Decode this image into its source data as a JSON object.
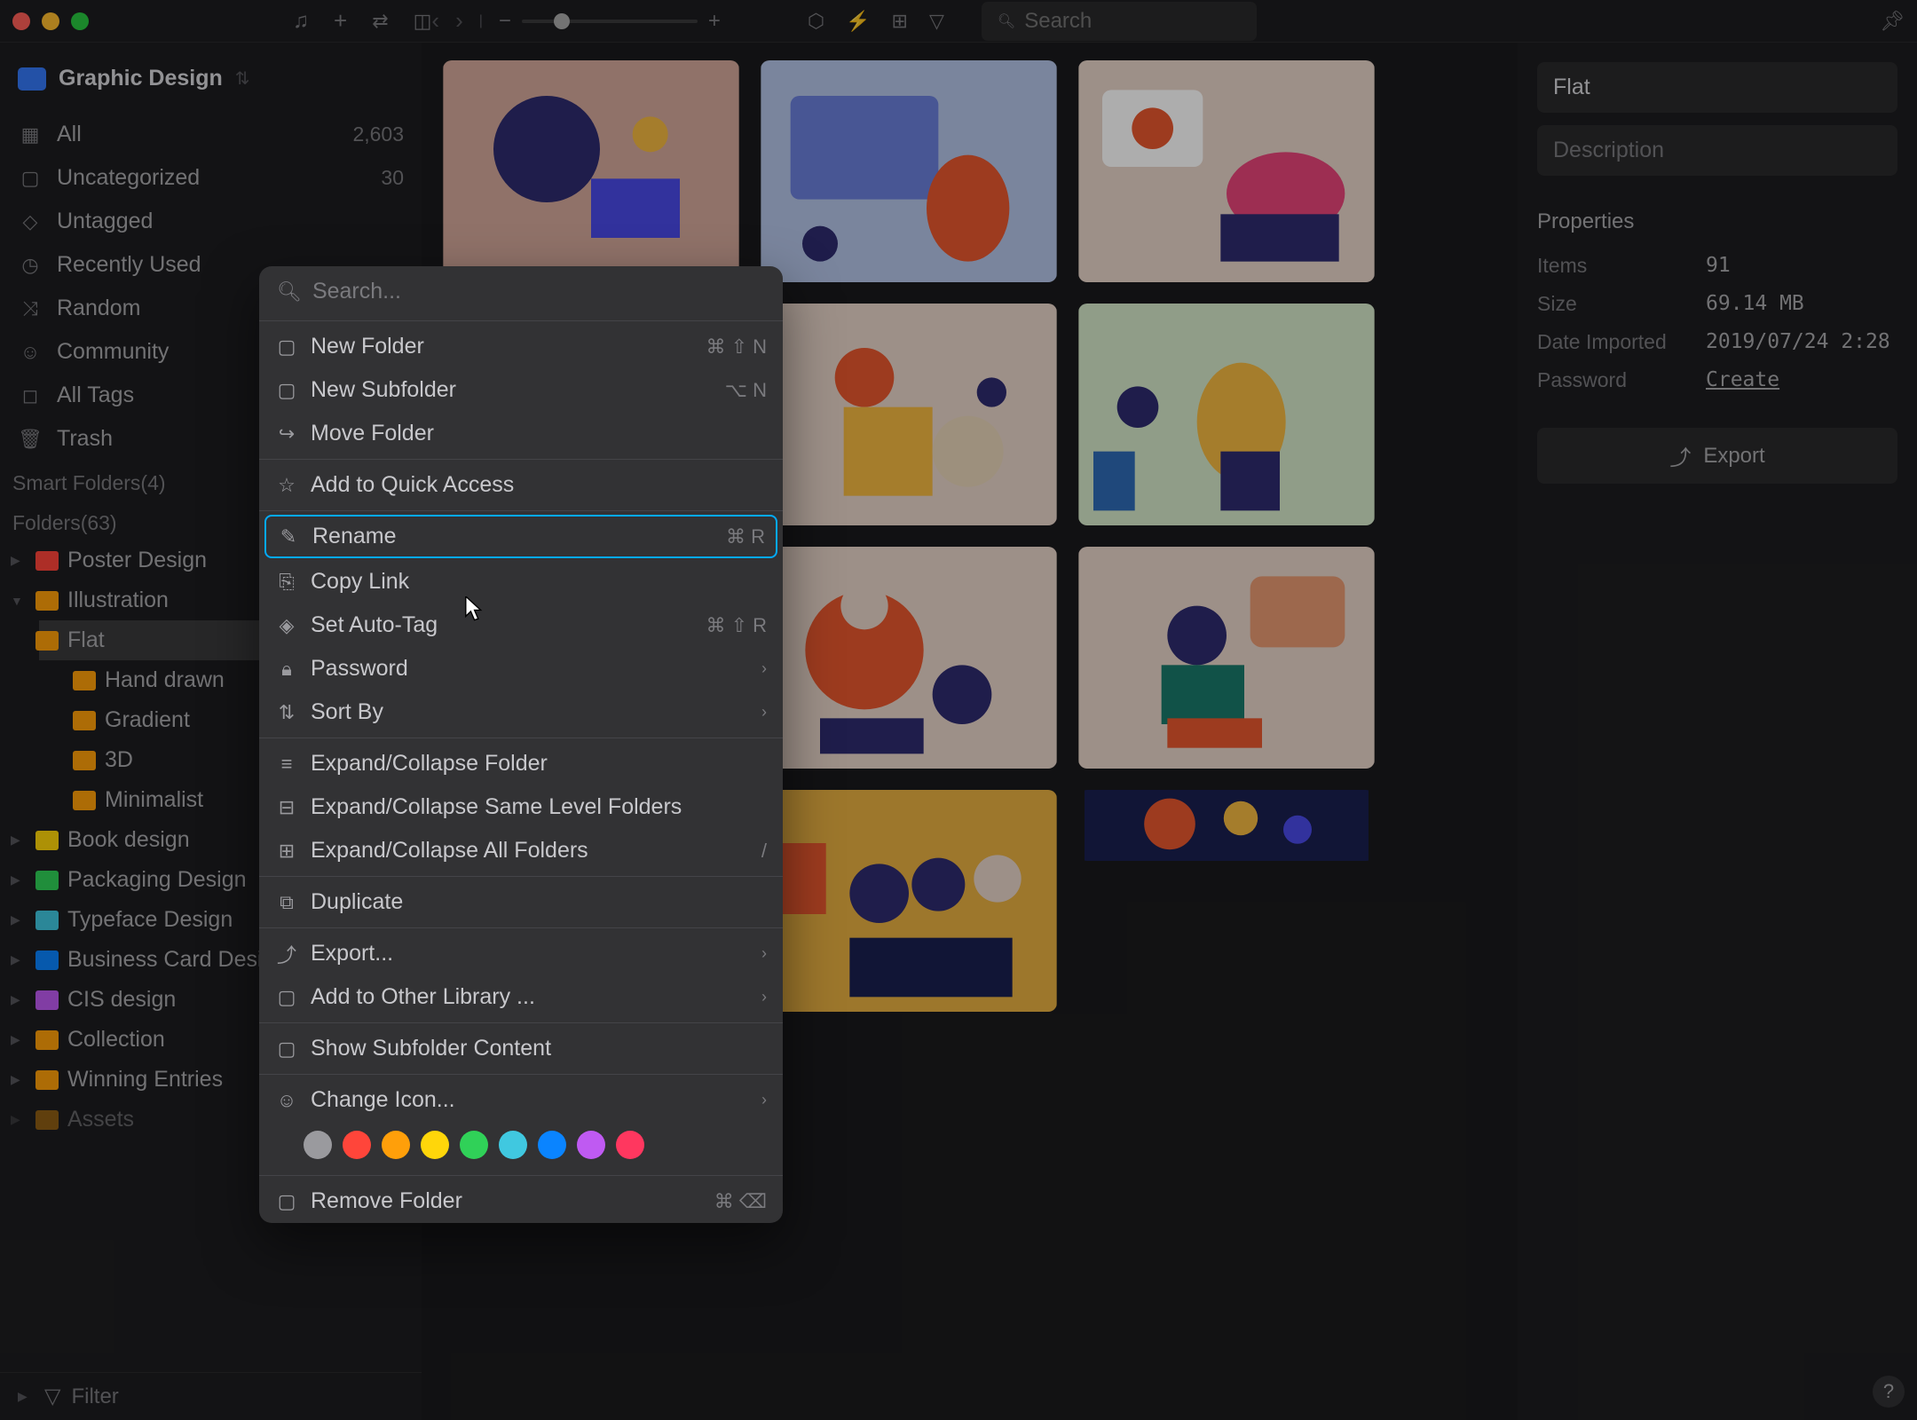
{
  "window_title": "Graphic Design",
  "toolbar": {
    "search_placeholder": "Search"
  },
  "sidebar": {
    "library_name": "Graphic Design",
    "nav": [
      {
        "icon": "grid",
        "label": "All",
        "count": "2,603"
      },
      {
        "icon": "folder",
        "label": "Uncategorized",
        "count": "30"
      },
      {
        "icon": "tag",
        "label": "Untagged",
        "count": ""
      },
      {
        "icon": "clock",
        "label": "Recently Used",
        "count": ""
      },
      {
        "icon": "shuffle",
        "label": "Random",
        "count": ""
      },
      {
        "icon": "people",
        "label": "Community",
        "count": ""
      },
      {
        "icon": "bookmark",
        "label": "All Tags",
        "count": ""
      },
      {
        "icon": "trash",
        "label": "Trash",
        "count": ""
      }
    ],
    "smart_folders_label": "Smart Folders(4)",
    "folders_label": "Folders(63)",
    "folders": [
      {
        "color": "fi-red",
        "label": "Poster Design"
      },
      {
        "color": "fi-orange",
        "label": "Illustration",
        "expanded": true,
        "children": [
          {
            "label": "Flat",
            "selected": true
          },
          {
            "label": "Hand drawn"
          },
          {
            "label": "Gradient"
          },
          {
            "label": "3D"
          },
          {
            "label": "Minimalist"
          }
        ]
      },
      {
        "color": "fi-yellow",
        "label": "Book design"
      },
      {
        "color": "fi-green",
        "label": "Packaging Design"
      },
      {
        "color": "fi-teal",
        "label": "Typeface Design"
      },
      {
        "color": "fi-blue",
        "label": "Business Card Design"
      },
      {
        "color": "fi-purple",
        "label": "CIS design"
      },
      {
        "color": "fi-orange",
        "label": "Collection"
      },
      {
        "color": "fi-orange",
        "label": "Winning Entries"
      },
      {
        "color": "fi-orange",
        "label": "Assets"
      }
    ],
    "filter_label": "Filter"
  },
  "context_menu": {
    "search_placeholder": "Search...",
    "groups": [
      [
        {
          "icon": "folder-plus",
          "label": "New Folder",
          "shortcut": "⌘ ⇧ N"
        },
        {
          "icon": "subfolder",
          "label": "New Subfolder",
          "shortcut": "⌥ N"
        },
        {
          "icon": "move",
          "label": "Move Folder"
        }
      ],
      [
        {
          "icon": "star",
          "label": "Add to Quick Access"
        }
      ],
      [
        {
          "icon": "rename",
          "label": "Rename",
          "shortcut": "⌘ R",
          "highlighted": true
        },
        {
          "icon": "link",
          "label": "Copy Link"
        },
        {
          "icon": "autotag",
          "label": "Set Auto-Tag",
          "shortcut": "⌘ ⇧ R"
        },
        {
          "icon": "lock",
          "label": "Password",
          "chevron": true
        },
        {
          "icon": "sort",
          "label": "Sort By",
          "chevron": true
        }
      ],
      [
        {
          "icon": "expand",
          "label": "Expand/Collapse Folder"
        },
        {
          "icon": "expand-same",
          "label": "Expand/Collapse Same Level Folders"
        },
        {
          "icon": "expand-all",
          "label": "Expand/Collapse All Folders",
          "shortcut": "/"
        }
      ],
      [
        {
          "icon": "duplicate",
          "label": "Duplicate"
        }
      ],
      [
        {
          "icon": "export",
          "label": "Export...",
          "chevron": true
        },
        {
          "icon": "library",
          "label": "Add to Other Library ...",
          "chevron": true
        }
      ],
      [
        {
          "icon": "show",
          "label": "Show Subfolder Content"
        }
      ],
      [
        {
          "icon": "icon",
          "label": "Change Icon...",
          "chevron": true
        }
      ]
    ],
    "colors": [
      "#9a9a9e",
      "#ff453a",
      "#ff9f0a",
      "#ffd60a",
      "#30d158",
      "#40c8e0",
      "#0a84ff",
      "#bf5af2",
      "#ff375f"
    ],
    "remove": {
      "icon": "folder-x",
      "label": "Remove Folder",
      "shortcut": "⌘ ⌫"
    }
  },
  "right_panel": {
    "title": "Flat",
    "description_label": "Description",
    "properties_label": "Properties",
    "props": [
      {
        "label": "Items",
        "value": "91"
      },
      {
        "label": "Size",
        "value": "69.14 MB"
      },
      {
        "label": "Date Imported",
        "value": "2019/07/24 2:28"
      },
      {
        "label": "Password",
        "value": "Create",
        "link": true
      }
    ],
    "export_label": "Export"
  }
}
